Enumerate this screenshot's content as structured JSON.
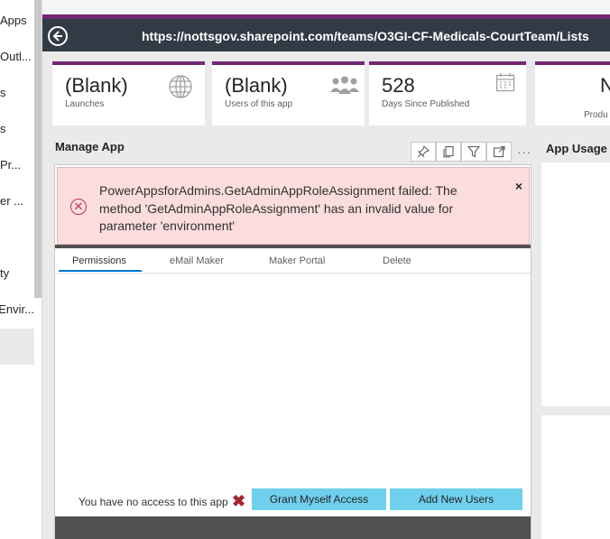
{
  "leftnav": {
    "items": [
      "Apps",
      "Outl...",
      "s",
      "s",
      "Pr...",
      "er ...",
      "ty",
      "Envir..."
    ]
  },
  "urlbar": {
    "url": "https://nottsgov.sharepoint.com/teams/O3GI-CF-Medicals-CourtTeam/Lists"
  },
  "cards": [
    {
      "value": "(Blank)",
      "label": "Launches",
      "icon": "globe-icon"
    },
    {
      "value": "(Blank)",
      "label": "Users of this app",
      "icon": "people-icon"
    },
    {
      "value": "528",
      "label": "Days Since Published",
      "icon": "calendar-icon"
    },
    {
      "value": "N",
      "label": "Produ"
    }
  ],
  "manage": {
    "title": "Manage App",
    "error_message": "PowerAppsforAdmins.GetAdminAppRoleAssignment failed: The method 'GetAdminAppRoleAssignment' has an invalid value for parameter 'environment'",
    "close_glyph": "×",
    "tabs": [
      "Permissions",
      "eMail Maker",
      "Maker Portal",
      "Delete"
    ],
    "no_access_text": "You have no access to this app",
    "grant_button": "Grant Myself Access",
    "add_users_button": "Add New Users"
  },
  "app_usage": {
    "title": "App Usage"
  },
  "colors": {
    "accent": "#742774",
    "button": "#6fd0ee",
    "error_bg": "#fbdddd",
    "error_icon": "#c4314b"
  }
}
